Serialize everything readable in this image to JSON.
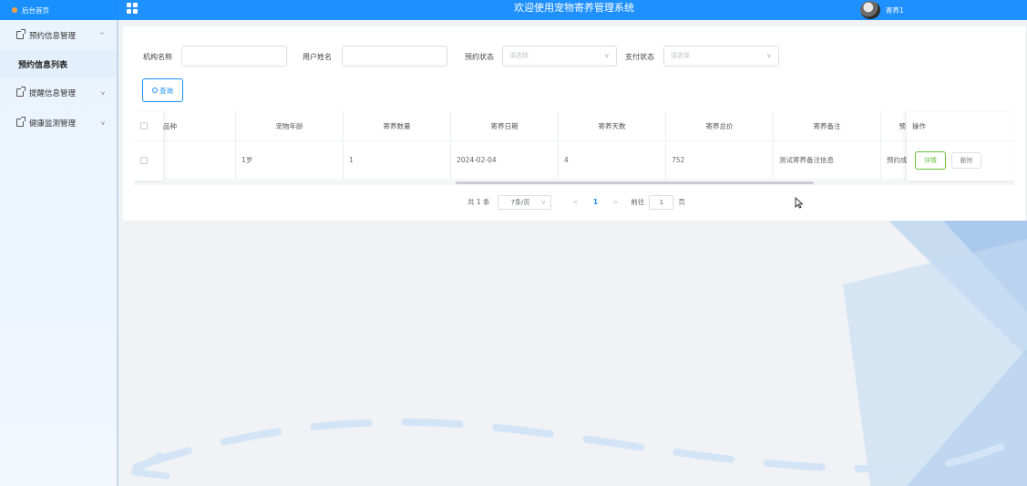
{
  "header": {
    "brand_label": "后台首页",
    "app_title": "欢迎使用宠物寄养管理系统",
    "username": "寄养1"
  },
  "sidebar": {
    "items": [
      {
        "label": "预约信息管理",
        "chevron": "^"
      },
      {
        "label": "预约信息列表"
      },
      {
        "label": "提醒信息管理",
        "chevron": "v"
      },
      {
        "label": "健康监测管理",
        "chevron": "v"
      }
    ]
  },
  "filters": {
    "org_name_label": "机构名称",
    "org_name_value": "",
    "user_name_label": "用户姓名",
    "user_name_value": "",
    "booking_status_label": "预约状态",
    "booking_status_placeholder": "请选择",
    "pay_status_label": "支付状态",
    "pay_status_placeholder": "请选择",
    "search_button": "查询"
  },
  "table": {
    "columns": [
      "品种",
      "宠物年龄",
      "寄养数量",
      "寄养日期",
      "寄养天数",
      "寄养总价",
      "寄养备注",
      "预",
      "操作"
    ],
    "rows": [
      {
        "breed": "",
        "age": "1岁",
        "count": "1",
        "date": "2024-02-04",
        "days": "4",
        "total": "752",
        "remark": "测试寄养备注信息",
        "status": "预约成"
      }
    ],
    "detail_button": "详情",
    "delete_button": "删除"
  },
  "pagination": {
    "total_text": "共 1 条",
    "page_size": "7条/页",
    "current_page": "1",
    "goto_label": "前往",
    "goto_value": "1",
    "page_suffix": "页"
  },
  "colors": {
    "header_bg": "#1e90ff",
    "accent": "#1890ff",
    "detail_green": "#67c23a"
  }
}
